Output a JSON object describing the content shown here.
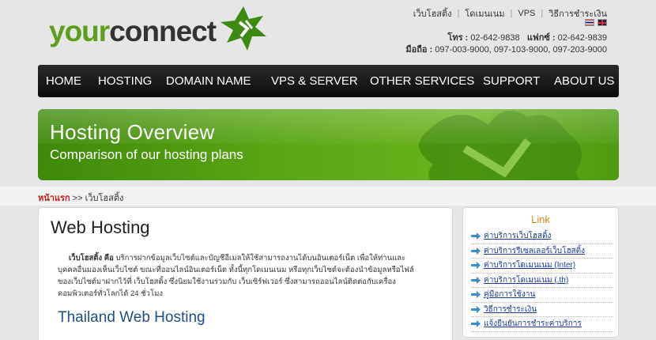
{
  "header": {
    "logo_your": "your",
    "logo_connect": "connect",
    "toplinks": [
      "เว็บโฮสติ้ง",
      "โดเมนเนม",
      "VPS",
      "วิธีการชำระเงิน"
    ],
    "phone_label": "โทร : ",
    "phone": "02-642-9838",
    "fax_label": "แฟกซ์ : ",
    "fax": "02-642-9839",
    "mobile_label": "มือถือ : ",
    "mobile": "097-003-9000, 097-103-9000, 097-203-9000"
  },
  "nav": {
    "items": [
      "HOME",
      "HOSTING",
      "DOMAIN NAME",
      "VPS & SERVER",
      "OTHER SERVICES",
      "SUPPORT",
      "ABOUT US"
    ]
  },
  "banner": {
    "title": "Hosting Overview",
    "subtitle": "Comparison of our hosting plans"
  },
  "breadcrumb": {
    "home": "หน้าแรก",
    "separator": " >> ",
    "current": "เว็บโฮสติ้ง"
  },
  "main": {
    "title": "Web Hosting",
    "para_bold": "เว็บโฮสติ้ง คือ",
    "para_line1": " บริการฝากข้อมูลเว็บไซต์และบัญชีอีเมลให้ใช้สามารถงานได้บนอินเตอร์เน็ต เพื่อให้ท่านและ",
    "para_line2": "บุคคลอื่นมองเห็นเว็บไซต์ ขณะที่ออนไลน์อินเตอร์เน็ต ทั้งนี้ทุกโดเมนเนม หรือทุกเว็บไซต์จะต้องนำข้อมูลหรือไฟล์",
    "para_line3": "ของเว็บไซต์มาฝากไว้ที่ เว็บโฮสติ้ง ซึ่งนิยมใช้งานร่วมกับ เว็บเซิร์ฟเวอร์ ซึ่งสามารถออนไลน์ติดต่อกับเครื่อง",
    "para_line4": "คอมพิวเตอร์ทั่วโลกได้ 24 ชั่วโมง",
    "subtitle": "Thailand Web Hosting"
  },
  "side": {
    "title": "Link",
    "links": [
      "ค่าบริการเว็บโฮสติ้ง",
      "ค่าบริการรีเซลเลอร์เว็บโฮสติ้ง",
      "ค่าบริการโดเมนเนม (Inter)",
      "ค่าบริการโดเมนเนม (.th)",
      "คู่มือการใช้งาน",
      "วิธีการชำระเงิน",
      "แจ้งยืนยันการชำระค่าบริการ"
    ]
  },
  "colors": {
    "brand_green": "#5e9d1e",
    "nav_bg": "#111111",
    "breadcrumb_home": "#c0211a",
    "link_blue": "#1a3d9a",
    "side_title": "#e08a1e",
    "subtitle_blue": "#1f4e8a"
  },
  "icons": [
    "star-leaf-logo-icon",
    "thai-flag-icon",
    "uk-flag-icon",
    "arrow-right-icon"
  ]
}
